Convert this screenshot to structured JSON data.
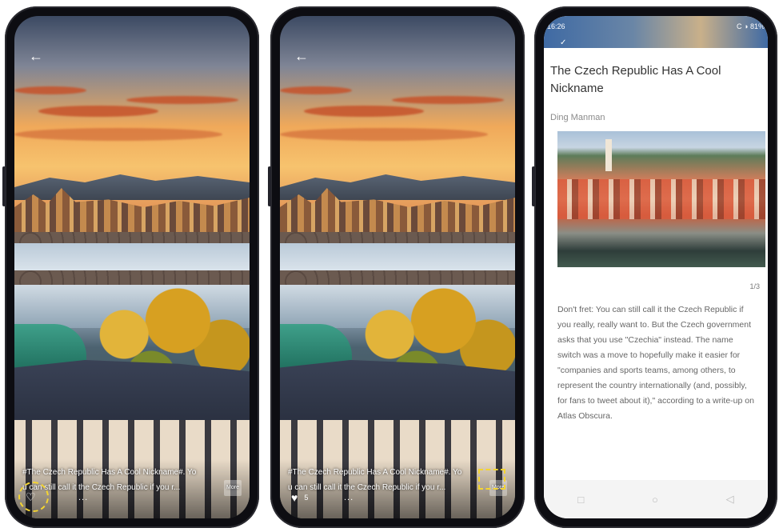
{
  "screen1": {
    "caption_line1": "#The Czech Republic Has A Cool Nickname#. Yo",
    "caption_line2": "u can still call it the Czech Republic if you r...",
    "more_label": "More",
    "like_count": "",
    "more_dots": "..."
  },
  "screen2": {
    "caption_line1": "#The Czech Republic Has A Cool Nickname#. Yo",
    "caption_line2": "u can still call it the Czech Republic if you r...",
    "more_label": "More",
    "like_count": "5",
    "more_dots": "..."
  },
  "screen3": {
    "status_time": "16:26",
    "status_right": "C ◑ 81%",
    "title": "The Czech Republic Has A Cool Nickname",
    "author": "Ding Manman",
    "page_indicator": "1/3",
    "body": "Don't fret: You can still call it the Czech Republic if you really, really want to. But the Czech government asks that you use \"Czechia\" instead. The name switch was a move to hopefully make it easier for \"companies and sports teams, among others, to represent the country internationally (and, possibly, for fans to tweet about it),\" according to a write-up on Atlas Obscura."
  },
  "icons": {
    "back": "back-arrow-icon",
    "heart": "heart-icon",
    "nav": [
      "square-icon",
      "circle-icon",
      "triangle-back-icon"
    ]
  },
  "colors": {
    "highlight": "#f5d531",
    "phone_frame": "#0d0d12"
  }
}
